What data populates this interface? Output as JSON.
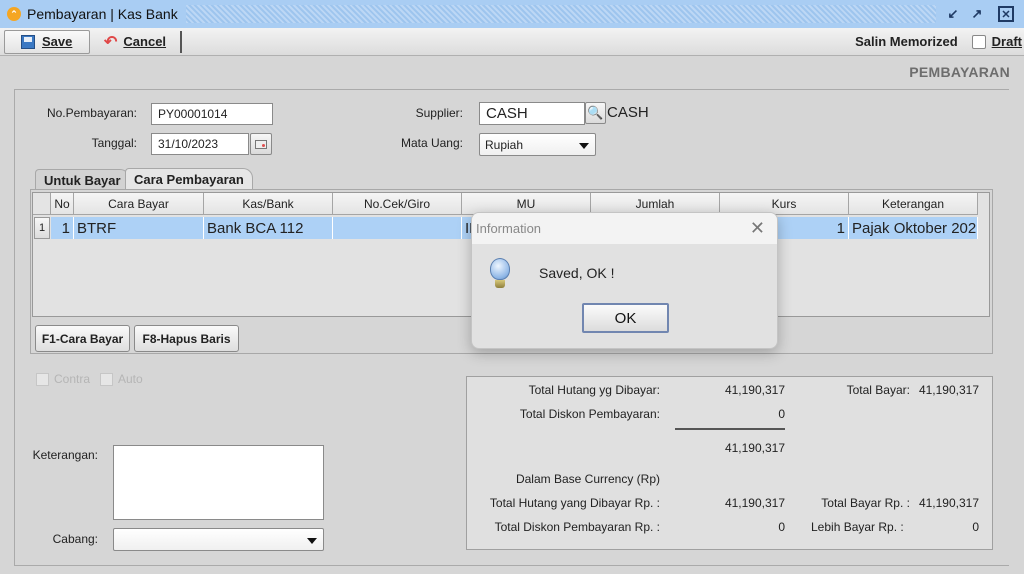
{
  "window": {
    "title": "Pembayaran | Kas Bank"
  },
  "toolbar": {
    "save_label": "Save",
    "cancel_label": "Cancel",
    "salin_memorized_label": "Salin Memorized",
    "draft_label": "Draft",
    "draft_checked": false
  },
  "page": {
    "heading": "PEMBAYARAN"
  },
  "form": {
    "no_pembayaran_label": "No.Pembayaran:",
    "no_pembayaran_value": "PY00001014",
    "tanggal_label": "Tanggal:",
    "tanggal_value": "31/10/2023",
    "supplier_label": "Supplier:",
    "supplier_code": "CASH",
    "supplier_name": "CASH",
    "mata_uang_label": "Mata Uang:",
    "mata_uang_value": "Rupiah"
  },
  "tabs": [
    {
      "label": "Untuk Bayar",
      "active": false
    },
    {
      "label": "Cara Pembayaran",
      "active": true
    }
  ],
  "grid": {
    "columns": [
      "No",
      "Cara Bayar",
      "Kas/Bank",
      "No.Cek/Giro",
      "MU",
      "Jumlah",
      "Kurs",
      "Keterangan"
    ],
    "rows": [
      {
        "row_header": "1",
        "no": "1",
        "cara_bayar": "BTRF",
        "kas_bank": "Bank BCA 112",
        "no_cek_giro": "",
        "mu": "IDR",
        "jumlah": "",
        "kurs": "1",
        "keterangan": "Pajak Oktober 202"
      }
    ]
  },
  "grid_buttons": {
    "f1": "F1-Cara Bayar",
    "f8": "F8-Hapus Baris"
  },
  "options": {
    "contra_label": "Contra",
    "auto_label": "Auto"
  },
  "bottom": {
    "keterangan_label": "Keterangan:",
    "keterangan_value": "",
    "cabang_label": "Cabang:",
    "cabang_value": ""
  },
  "summary": {
    "total_hutang_label": "Total Hutang yg Dibayar:",
    "total_hutang_value": "41,190,317",
    "total_diskon_label": "Total Diskon Pembayaran:",
    "total_diskon_value": "0",
    "subtotal_value": "41,190,317",
    "total_bayar_label": "Total Bayar:",
    "total_bayar_value": "41,190,317",
    "base_currency_label": "Dalam Base Currency (Rp)",
    "total_hutang_rp_label": "Total Hutang yang Dibayar Rp. :",
    "total_hutang_rp_value": "41,190,317",
    "total_bayar_rp_label": "Total Bayar Rp. :",
    "total_bayar_rp_value": "41,190,317",
    "total_diskon_rp_label": "Total Diskon Pembayaran Rp. :",
    "total_diskon_rp_value": "0",
    "lebih_bayar_rp_label": "Lebih Bayar Rp. :",
    "lebih_bayar_rp_value": "0"
  },
  "dialog": {
    "title": "Information",
    "message": "Saved, OK !",
    "ok_label": "OK"
  }
}
